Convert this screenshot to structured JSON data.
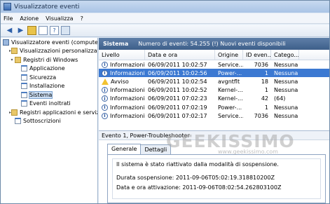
{
  "window": {
    "title": "Visualizzatore eventi"
  },
  "menu": {
    "items": [
      "File",
      "Azione",
      "Visualizza",
      "?"
    ]
  },
  "tree": {
    "items": [
      {
        "label": "Visualizzatore eventi (computer",
        "level": 0,
        "icon": "pc-icon"
      },
      {
        "label": "Visualizzazioni personalizzate",
        "level": 1,
        "icon": "folder-icon",
        "expander": "▸"
      },
      {
        "label": "Registri di Windows",
        "level": 1,
        "icon": "folder-icon",
        "expander": "▾"
      },
      {
        "label": "Applicazione",
        "level": 2,
        "icon": "log-icon"
      },
      {
        "label": "Sicurezza",
        "level": 2,
        "icon": "log-icon"
      },
      {
        "label": "Installazione",
        "level": 2,
        "icon": "log-icon"
      },
      {
        "label": "Sistema",
        "level": 2,
        "icon": "log-icon",
        "selected": true
      },
      {
        "label": "Eventi inoltrati",
        "level": 2,
        "icon": "log-icon"
      },
      {
        "label": "Registri applicazioni e servizi",
        "level": 1,
        "icon": "folder-icon",
        "expander": "▸"
      },
      {
        "label": "Sottoscrizioni",
        "level": 1,
        "icon": "log-icon"
      }
    ]
  },
  "header": {
    "name": "Sistema",
    "info": "Numero di eventi: 54.255 (!) Nuovi eventi disponibili"
  },
  "table": {
    "columns": [
      "Livello",
      "Data e ora",
      "Origine",
      "ID even...",
      "Catego..."
    ],
    "rows": [
      {
        "level": "Informazioni",
        "kind": "info",
        "date": "06/09/2011 10:02:57",
        "source": "Service...",
        "id": "7036",
        "category": "Nessuna"
      },
      {
        "level": "Informazioni",
        "kind": "info",
        "date": "06/09/2011 10:02:56",
        "source": "Power-...",
        "id": "1",
        "category": "Nessuna",
        "selected": true
      },
      {
        "level": "Avviso",
        "kind": "warning",
        "date": "06/09/2011 10:02:54",
        "source": "avgntflt",
        "id": "18",
        "category": "Nessuna"
      },
      {
        "level": "Informazioni",
        "kind": "info",
        "date": "06/09/2011 10:02:52",
        "source": "Kernel-...",
        "id": "1",
        "category": "Nessuna"
      },
      {
        "level": "Informazioni",
        "kind": "info",
        "date": "06/09/2011 07:02:23",
        "source": "Kernel-...",
        "id": "42",
        "category": "(64)"
      },
      {
        "level": "Informazioni",
        "kind": "info",
        "date": "06/09/2011 07:02:19",
        "source": "Power-...",
        "id": "1",
        "category": "Nessuna"
      },
      {
        "level": "Informazioni",
        "kind": "info",
        "date": "06/09/2011 07:02:17",
        "source": "Service...",
        "id": "7036",
        "category": "Nessuna"
      }
    ]
  },
  "detail": {
    "title": "Evento 1, Power-Troubleshooter",
    "tabs": [
      "Generale",
      "Dettagli"
    ],
    "line1": "Il sistema è stato riattivato dalla modalità di sospensione.",
    "line2": "Durata sospensione: 2011-09-06T05:02:19.318810200Z",
    "line3": "Data e ora attivazione: 2011-09-06T08:02:54.262803100Z"
  },
  "watermark": {
    "text": "GEEKISSIMO",
    "sub": "www.geekissimo.com"
  }
}
